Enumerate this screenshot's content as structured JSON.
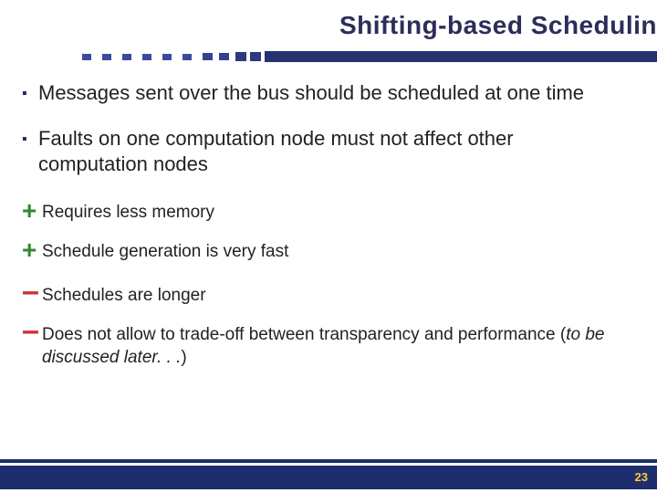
{
  "title": "Shifting-based Schedulin",
  "bullets": {
    "main": [
      "Messages sent over the bus should be scheduled at one time",
      "Faults on one computation node must not affect other computation nodes"
    ],
    "plus": [
      "Requires less memory",
      "Schedule generation is very fast"
    ],
    "minus": [
      "Schedules are longer"
    ],
    "minus_with_italic": {
      "prefix": "Does not allow to trade-off between transparency and performance (",
      "italic": "to be discussed later. . .",
      "suffix": ")"
    }
  },
  "page_number": "23"
}
